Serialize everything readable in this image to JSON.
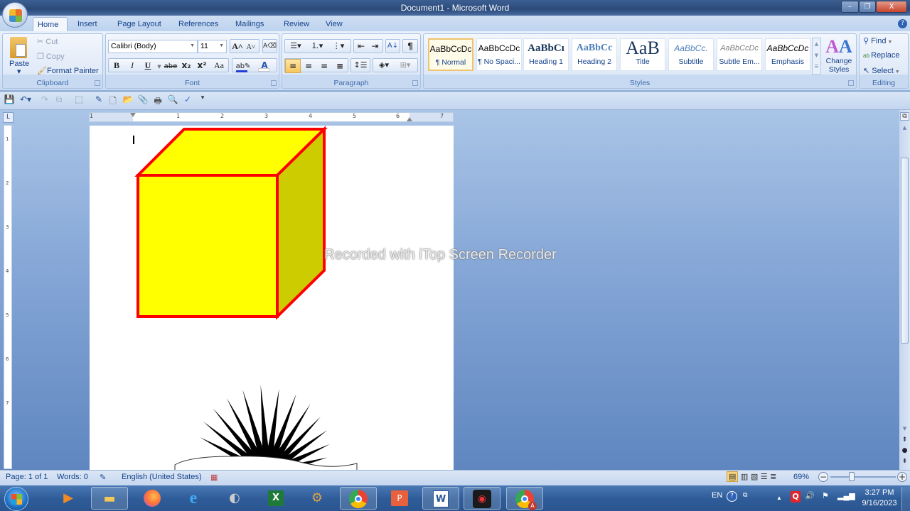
{
  "window": {
    "title": "Document1 - Microsoft Word",
    "minimize": "–",
    "restore": "❐",
    "close": "X",
    "help": "?"
  },
  "tabs": [
    "Home",
    "Insert",
    "Page Layout",
    "References",
    "Mailings",
    "Review",
    "View"
  ],
  "active_tab": "Home",
  "clipboard": {
    "label": "Clipboard",
    "paste": "Paste",
    "cut": "Cut",
    "copy": "Copy",
    "format_painter": "Format Painter"
  },
  "font": {
    "label": "Font",
    "font_name": "Calibri (Body)",
    "font_size": "11",
    "bold": "B",
    "italic": "I",
    "underline": "U",
    "strikethrough": "abe",
    "subscript": "x₂",
    "superscript": "x²",
    "change_case": "Aa",
    "grow_font": "A˄",
    "shrink_font": "A˅",
    "highlight_color": "#1f3fd8",
    "font_color": "#ffffff"
  },
  "paragraph": {
    "label": "Paragraph",
    "show_marks": "¶"
  },
  "styles": {
    "label": "Styles",
    "items": [
      {
        "sample": "AaBbCcDc",
        "name": "¶ Normal",
        "selected": true
      },
      {
        "sample": "AaBbCcDc",
        "name": "¶ No Spaci...",
        "selected": false
      },
      {
        "sample": "AaBbCı",
        "name": "Heading 1",
        "selected": false
      },
      {
        "sample": "AaBbCc",
        "name": "Heading 2",
        "selected": false
      },
      {
        "sample": "AaB",
        "name": "Title",
        "selected": false
      },
      {
        "sample": "AaBbCc.",
        "name": "Subtitle",
        "selected": false
      },
      {
        "sample": "AaBbCcDc",
        "name": "Subtle Em...",
        "selected": false
      },
      {
        "sample": "AaBbCcDc",
        "name": "Emphasis",
        "selected": false
      }
    ],
    "change_styles": "Change Styles"
  },
  "editing": {
    "label": "Editing",
    "find": "Find",
    "replace": "Replace",
    "select": "Select"
  },
  "ruler": {
    "h_ticks": [
      "1",
      "1",
      "2",
      "3",
      "4",
      "5",
      "6",
      "7"
    ],
    "v_ticks": [
      "1",
      "2",
      "3",
      "4",
      "5",
      "6",
      "7"
    ]
  },
  "document": {
    "shapes": [
      {
        "type": "cube",
        "fill": "#ffff00",
        "side_fill": "#cccc00",
        "stroke": "#ff0000"
      },
      {
        "type": "starburst",
        "fill": "#000000"
      }
    ]
  },
  "watermark": "Recorded with iTop Screen Recorder",
  "status": {
    "page": "Page: 1 of 1",
    "words": "Words: 0",
    "language": "English (United States)",
    "zoom": "69%",
    "zoom_percent": 69
  },
  "taskbar": {
    "apps": [
      "media-player",
      "file-explorer",
      "firefox",
      "internet-explorer",
      "app-listen",
      "excel",
      "app-clock",
      "chrome",
      "powerpoint",
      "word",
      "itop-recorder",
      "chrome-profile"
    ],
    "active": [
      "file-explorer",
      "chrome",
      "word",
      "itop-recorder",
      "chrome-profile"
    ],
    "lang": "EN",
    "time": "3:27 PM",
    "date": "9/16/2023"
  }
}
